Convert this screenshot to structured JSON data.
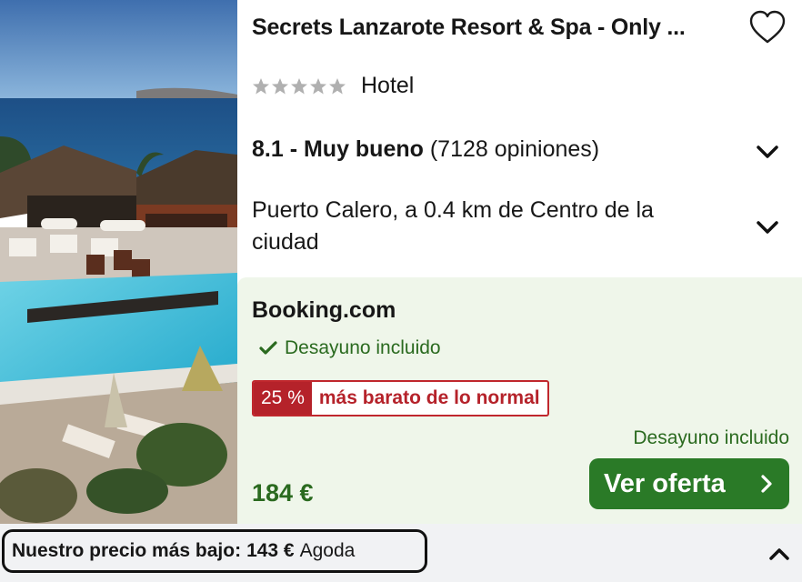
{
  "hotel": {
    "name": "Secrets Lanzarote Resort & Spa - Only ...",
    "star_count": 5,
    "type": "Hotel",
    "rating_label": "8.1 - Muy bueno",
    "reviews": "(7128 opiniones)",
    "location": "Puerto Calero, a 0.4 km de Centro de la ciudad"
  },
  "deal": {
    "provider": "Booking.com",
    "breakfast": "Desayuno incluido",
    "discount_pct": "25 %",
    "discount_text": "más barato de lo normal",
    "breakfast_note": "Desayuno incluido",
    "price": "184 €",
    "cta_label": "Ver oferta"
  },
  "lowest": {
    "label": "Nuestro precio más bajo:",
    "price": "143 €",
    "provider": "Agoda"
  },
  "icons": {
    "favorite": "heart-outline-icon",
    "expand": "chevron-down-icon",
    "check": "check-icon",
    "cta_arrow": "chevron-right-icon",
    "collapse": "chevron-up-icon"
  },
  "colors": {
    "accent_green": "#2a7a27",
    "text_green": "#2a6a1f",
    "deal_bg": "#eff6ea",
    "discount_red": "#b5222a",
    "star_gray": "#b0b0b0"
  }
}
